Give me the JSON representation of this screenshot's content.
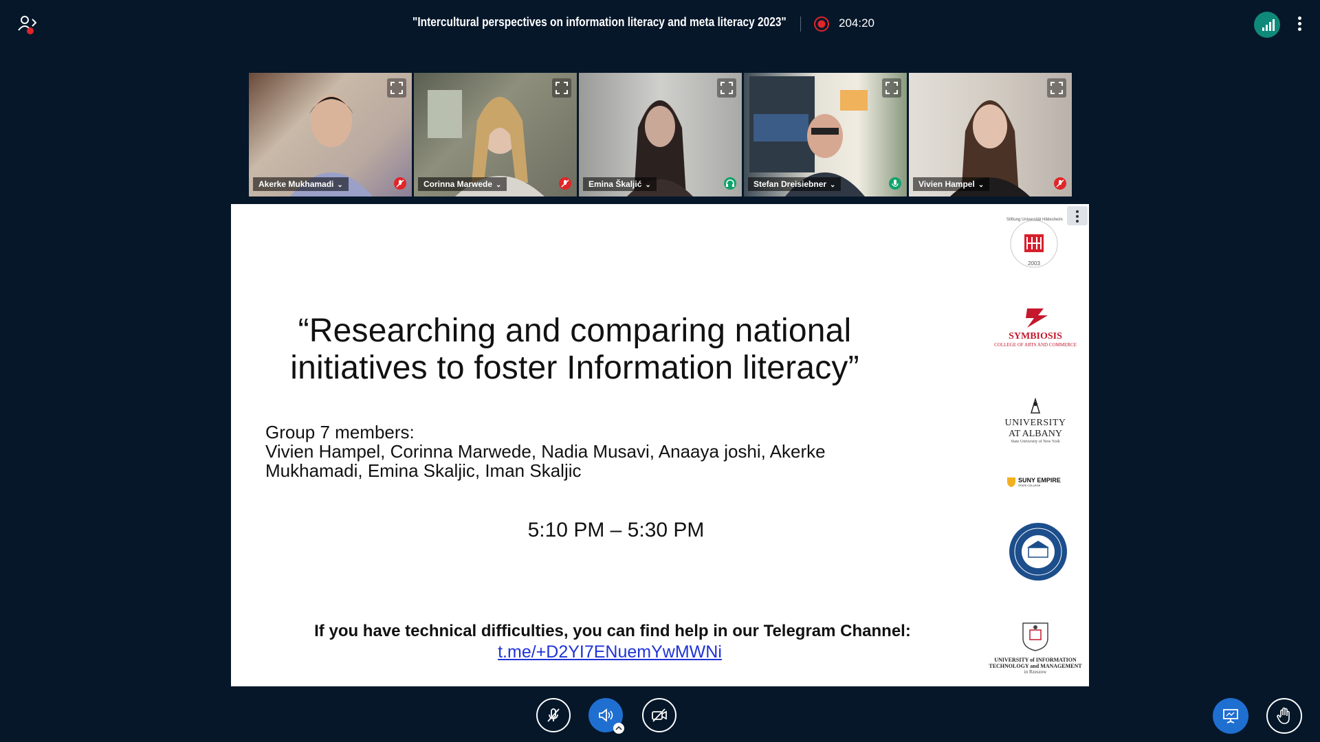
{
  "header": {
    "meeting_title": "\"Intercultural perspectives on information literacy and meta literacy 2023\"",
    "recording_time": "204:20"
  },
  "participants": [
    {
      "name": "Akerke Mukhamadi",
      "status": "muted",
      "bg": "#c9b9a8"
    },
    {
      "name": "Corinna Marwede",
      "status": "muted",
      "bg": "#8e8f7c"
    },
    {
      "name": "Emina Škaljić",
      "status": "listen-only",
      "bg": "#c4c4c0"
    },
    {
      "name": "Stefan Dreisiebner",
      "status": "talking",
      "bg": "#d9d6cc"
    },
    {
      "name": "Vivien Hampel",
      "status": "muted",
      "bg": "#d8d3cc"
    }
  ],
  "slide": {
    "title_line1": "“Researching and comparing national",
    "title_line2": "initiatives to foster Information literacy”",
    "members_heading": "Group 7 members:",
    "members_line1": "Vivien Hampel, Corinna Marwede, Nadia Musavi, Anaaya joshi, Akerke",
    "members_line2": "Mukhamadi, Emina Skaljic, Iman Skaljic",
    "time_range": "5:10 PM – 5:30 PM",
    "help_text": "If you have technical difficulties, you can find help in our Telegram Channel:",
    "help_link": "t.me/+D2YI7ENuemYwMWNi",
    "logos": {
      "hildesheim_ring": "Stiftung Universität Hildesheim",
      "hildesheim_year": "2003",
      "symbiosis_name": "SYMBIOSIS",
      "symbiosis_sub": "COLLEGE OF ARTS AND COMMERCE",
      "albany_line1": "UNIVERSITY",
      "albany_line2": "AT ALBANY",
      "albany_sub": "State University of New York",
      "suny_name": "SUNY EMPIRE",
      "suny_sub": "STATE COLLEGE",
      "uitm_line1": "UNIVERSITY of INFORMATION",
      "uitm_line2": "TECHNOLOGY and MANAGEMENT",
      "uitm_line3": "in Rzeszow"
    }
  },
  "colors": {
    "background": "#06172a",
    "primary": "#1f6fd1",
    "muted_red": "#e0262a",
    "talking_green": "#11a36c",
    "link_blue": "#1f33d6"
  }
}
